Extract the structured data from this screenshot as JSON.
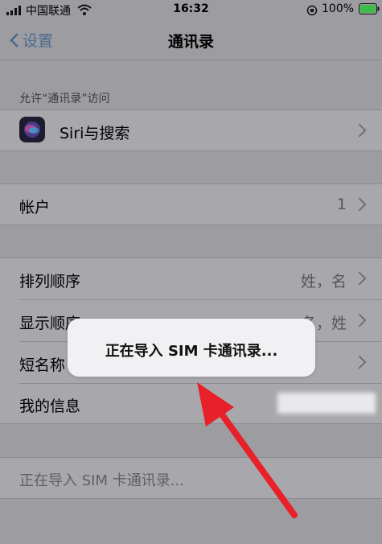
{
  "status_bar": {
    "carrier": "中国联通",
    "time": "16:32",
    "battery": "100%"
  },
  "nav": {
    "back_label": "设置",
    "title": "通讯录"
  },
  "section_allow_access": "允许“通讯录”访问",
  "rows": {
    "siri": {
      "label": "Siri与搜索"
    },
    "accounts": {
      "label": "帐户",
      "value": "1"
    },
    "sort_order": {
      "label": "排列顺序",
      "value": "姓，名"
    },
    "display_order": {
      "label": "显示顺序",
      "value": "名，姓"
    },
    "short_name": {
      "label": "短名称"
    },
    "my_info": {
      "label": "我的信息"
    },
    "import_sim": {
      "label": "正在导入 SIM 卡通讯录..."
    }
  },
  "toast": {
    "message": "正在导入 SIM 卡通讯录..."
  },
  "colors": {
    "annotation_arrow": "#e8202a",
    "siri_icon_bg": "#1c1c2e"
  }
}
